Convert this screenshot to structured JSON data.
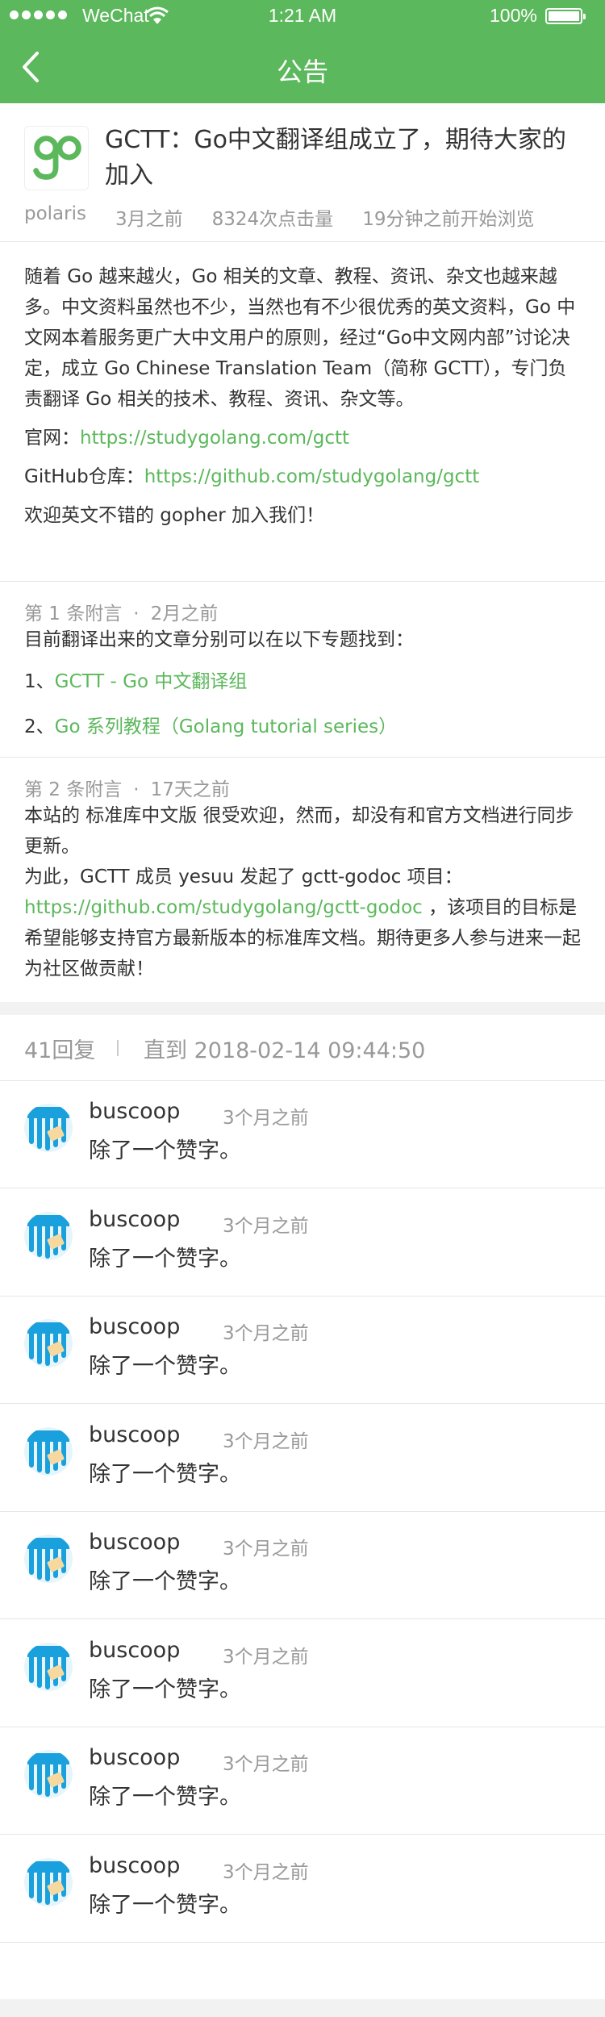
{
  "status_bar": {
    "carrier": "WeChat",
    "time": "1:21 AM",
    "battery": "100%"
  },
  "nav": {
    "title": "公告",
    "back_icon": "chevron-left-icon"
  },
  "article": {
    "title": "GCTT：Go中文翻译组成立了，期待大家的加入",
    "author": "polaris",
    "posted": "3月之前",
    "clicks": "8324次点击量",
    "browsing": "19分钟之前开始浏览",
    "paragraph": "随着 Go 越来越火，Go 相关的文章、教程、资讯、杂文也越来越多。中文资料虽然也不少，当然也有不少很优秀的英文资料，Go 中文网本着服务更广大中文用户的原则，经过“Go中文网内部”讨论决定，成立 Go Chinese Translation Team（简称 GCTT），专门负责翻译 Go 相关的技术、教程、资讯、杂文等。",
    "website_label": "官网：",
    "website_url": "https://studygolang.com/gctt",
    "github_label": "GitHub仓库：",
    "github_url": "https://github.com/studygolang/gctt",
    "welcome": "欢迎英文不错的 gopher 加入我们！"
  },
  "appendix1": {
    "label": "第 1 条附言",
    "dot": "·",
    "time": "2月之前",
    "intro": "目前翻译出来的文章分别可以在以下专题找到：",
    "item1_prefix": "1、",
    "item1_link": "GCTT - Go 中文翻译组",
    "item2_prefix": "2、",
    "item2_link": "Go 系列教程（Golang tutorial series）"
  },
  "appendix2": {
    "label": "第 2 条附言",
    "dot": "·",
    "time": "17天之前",
    "text1": "本站的 标准库中文版 很受欢迎，然而，却没有和官方文档进行同步更新。",
    "text2": "为此，GCTT 成员 yesuu 发起了 gctt-godoc 项目：",
    "link": "https://github.com/studygolang/gctt-godoc",
    "text3": " ，该项目的目标是希望能够支持官方最新版本的标准库文档。期待更多人参与进来一起为社区做贡献！"
  },
  "replies_header": {
    "count": "41回复",
    "until": "直到 2018-02-14  09:44:50"
  },
  "replies": [
    {
      "user": "buscoop",
      "time": "3个月之前",
      "content": "除了一个赞字。"
    },
    {
      "user": "buscoop",
      "time": "3个月之前",
      "content": "除了一个赞字。"
    },
    {
      "user": "buscoop",
      "time": "3个月之前",
      "content": "除了一个赞字。"
    },
    {
      "user": "buscoop",
      "time": "3个月之前",
      "content": "除了一个赞字。"
    },
    {
      "user": "buscoop",
      "time": "3个月之前",
      "content": "除了一个赞字。"
    },
    {
      "user": "buscoop",
      "time": "3个月之前",
      "content": "除了一个赞字。"
    },
    {
      "user": "buscoop",
      "time": "3个月之前",
      "content": "除了一个赞字。"
    },
    {
      "user": "buscoop",
      "time": "3个月之前",
      "content": "除了一个赞字。"
    }
  ],
  "colors": {
    "brand_green": "#5cb85c",
    "text": "#333333",
    "muted": "#999999"
  }
}
